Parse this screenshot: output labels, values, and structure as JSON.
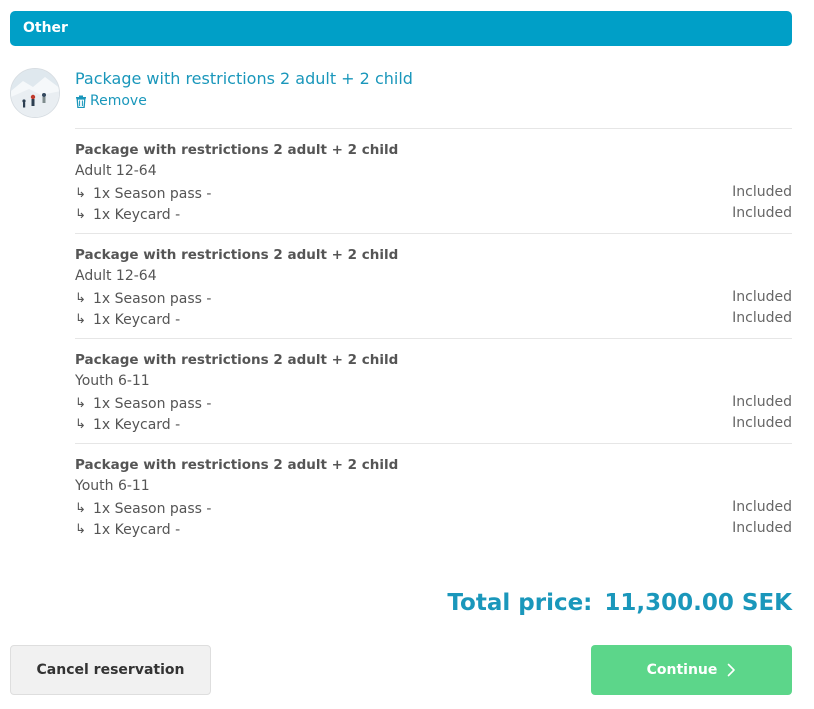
{
  "section": {
    "title": "Other"
  },
  "package": {
    "title": "Package with restrictions 2 adult + 2 child",
    "remove_label": "Remove",
    "remove_icon": "trash-icon"
  },
  "items": [
    {
      "title": "Package with restrictions 2 adult + 2 child",
      "age": "Adult 12-64",
      "lines": [
        {
          "label": "1x Season pass -",
          "price": "Included"
        },
        {
          "label": "1x Keycard -",
          "price": "Included"
        }
      ]
    },
    {
      "title": "Package with restrictions 2 adult + 2 child",
      "age": "Adult 12-64",
      "lines": [
        {
          "label": "1x Season pass -",
          "price": "Included"
        },
        {
          "label": "1x Keycard -",
          "price": "Included"
        }
      ]
    },
    {
      "title": "Package with restrictions 2 adult + 2 child",
      "age": "Youth 6-11",
      "lines": [
        {
          "label": "1x Season pass -",
          "price": "Included"
        },
        {
          "label": "1x Keycard -",
          "price": "Included"
        }
      ]
    },
    {
      "title": "Package with restrictions 2 adult + 2 child",
      "age": "Youth 6-11",
      "lines": [
        {
          "label": "1x Season pass -",
          "price": "Included"
        },
        {
          "label": "1x Keycard -",
          "price": "Included"
        }
      ]
    }
  ],
  "arrow_glyph": "↳",
  "total": {
    "label": "Total price:",
    "value": "11,300.00 SEK"
  },
  "buttons": {
    "cancel": "Cancel reservation",
    "continue": "Continue"
  },
  "colors": {
    "header": "#009fc7",
    "link": "#1a97bb",
    "continue": "#5cd68a"
  }
}
